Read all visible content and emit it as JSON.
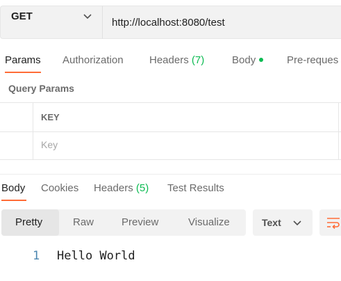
{
  "request": {
    "method": "GET",
    "url": "http://localhost:8080/test"
  },
  "request_tabs": {
    "params": "Params",
    "authorization": "Authorization",
    "headers_label": "Headers",
    "headers_count": "(7)",
    "body": "Body",
    "pre_request": "Pre-reques"
  },
  "query_params": {
    "title": "Query Params",
    "key_header": "KEY",
    "key_placeholder": "Key"
  },
  "response_tabs": {
    "body": "Body",
    "cookies": "Cookies",
    "headers_label": "Headers",
    "headers_count": "(5)",
    "test_results": "Test Results"
  },
  "body_view": {
    "pretty": "Pretty",
    "raw": "Raw",
    "preview": "Preview",
    "visualize": "Visualize",
    "format": "Text"
  },
  "response_body": {
    "line_number": "1",
    "content": "Hello World"
  },
  "colors": {
    "accent": "#ff6c37",
    "count_green": "#0cbb52",
    "line_number": "#4b86b0"
  },
  "icons": [
    "chevron-down-icon",
    "wrap-lines-icon",
    "status-dot-icon"
  ]
}
